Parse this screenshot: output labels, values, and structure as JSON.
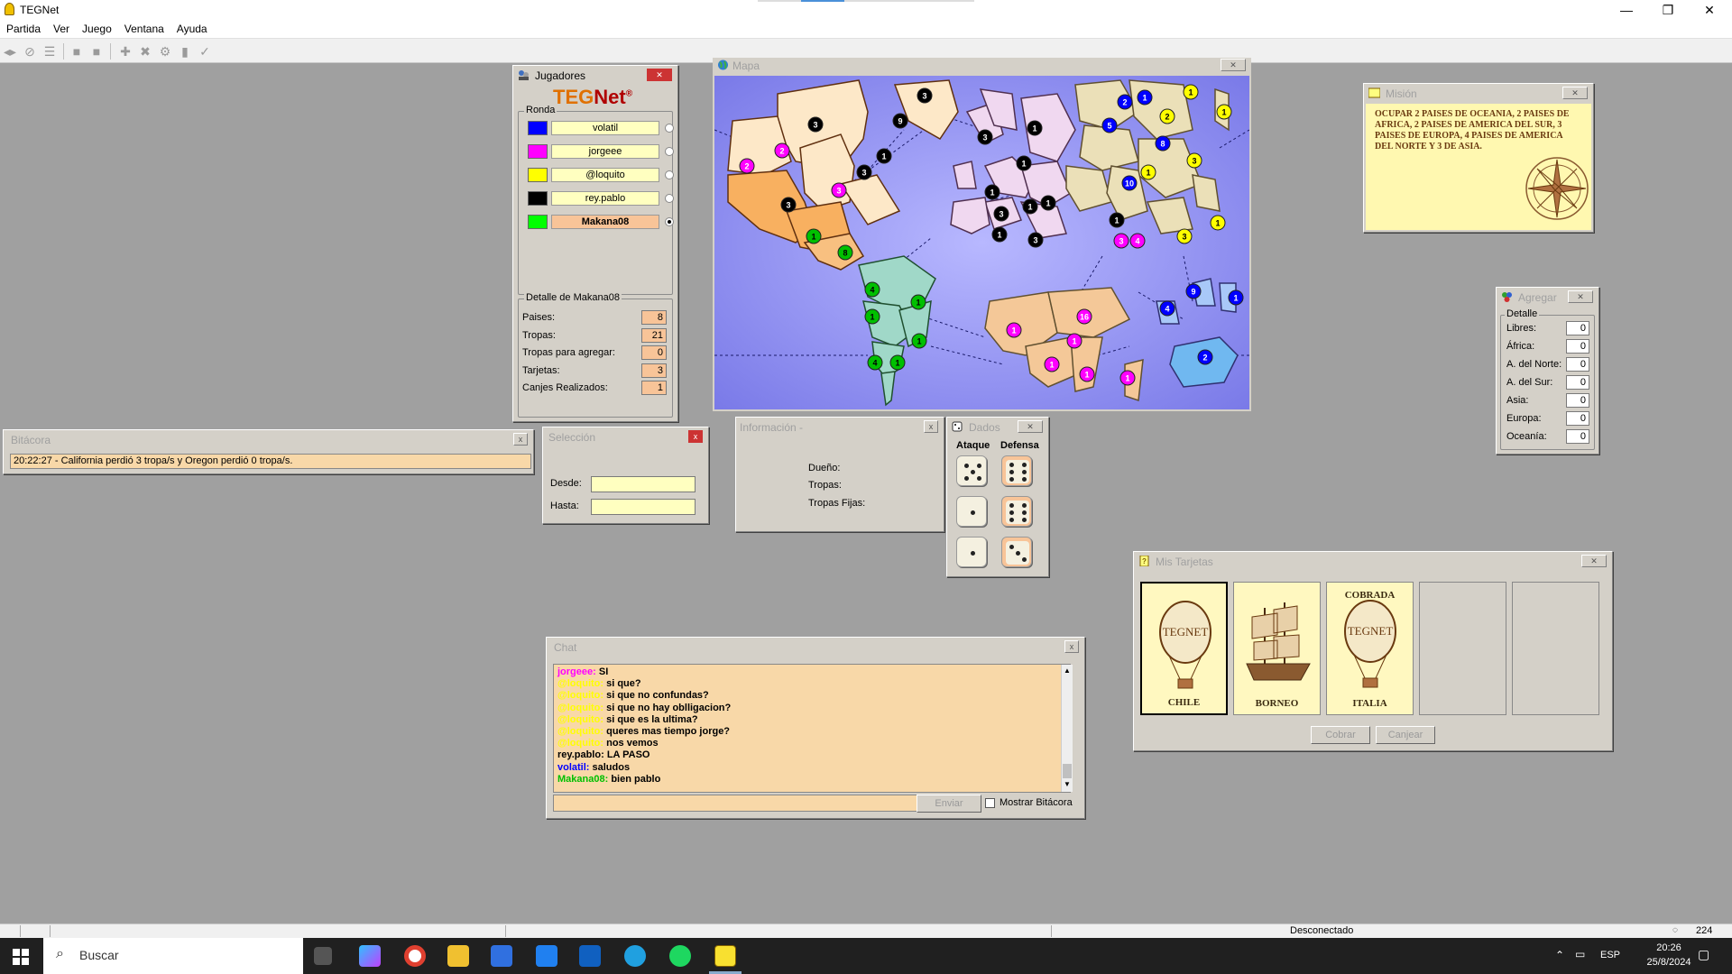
{
  "window": {
    "title": "TEGNet",
    "min_glyph": "—",
    "max_glyph": "❐",
    "close_glyph": "✕"
  },
  "menu": [
    "Partida",
    "Ver",
    "Juego",
    "Ventana",
    "Ayuda"
  ],
  "players_panel": {
    "title": "Jugadores",
    "logo_teg": "TEG",
    "logo_net": "Net",
    "logo_mark": "®",
    "group_label": "Ronda",
    "players": [
      {
        "name": "volatil",
        "color": "#0000ff",
        "active": false
      },
      {
        "name": "jorgeee",
        "color": "#ff00ff",
        "active": false
      },
      {
        "name": "@loquito",
        "color": "#ffff00",
        "active": false
      },
      {
        "name": "rey.pablo",
        "color": "#000000",
        "active": false
      },
      {
        "name": "Makana08",
        "color": "#00ff00",
        "active": true
      }
    ],
    "detail_label": "Detalle de Makana08",
    "stats": [
      {
        "label": "Paises:",
        "value": "8"
      },
      {
        "label": "Tropas:",
        "value": "21"
      },
      {
        "label": "Tropas para agregar:",
        "value": "0"
      },
      {
        "label": "Tarjetas:",
        "value": "3"
      },
      {
        "label": "Canjes Realizados:",
        "value": "1"
      }
    ]
  },
  "map_panel": {
    "title": "Mapa"
  },
  "map_armies": [
    {
      "n": "3",
      "c": "#000",
      "fg": "#fff"
    },
    {
      "n": "2",
      "c": "#ff00ff",
      "fg": "#fff"
    },
    {
      "n": "2",
      "c": "#ff00ff",
      "fg": "#fff"
    },
    {
      "n": "1",
      "c": "#000",
      "fg": "#fff"
    },
    {
      "n": "3",
      "c": "#000",
      "fg": "#fff"
    },
    {
      "n": "3",
      "c": "#000",
      "fg": "#fff"
    },
    {
      "n": "3",
      "c": "#ff00ff",
      "fg": "#fff"
    },
    {
      "n": "9",
      "c": "#000",
      "fg": "#fff"
    },
    {
      "n": "1",
      "c": "#00c000",
      "fg": "#000"
    },
    {
      "n": "8",
      "c": "#00c000",
      "fg": "#000"
    },
    {
      "n": "3",
      "c": "#000",
      "fg": "#fff"
    },
    {
      "n": "4",
      "c": "#00c000",
      "fg": "#000"
    },
    {
      "n": "1",
      "c": "#00c000",
      "fg": "#000"
    },
    {
      "n": "1",
      "c": "#00c000",
      "fg": "#000"
    },
    {
      "n": "1",
      "c": "#00c000",
      "fg": "#000"
    },
    {
      "n": "4",
      "c": "#00c000",
      "fg": "#000"
    },
    {
      "n": "1",
      "c": "#00c000",
      "fg": "#000"
    },
    {
      "n": "3",
      "c": "#000",
      "fg": "#fff"
    },
    {
      "n": "1",
      "c": "#000",
      "fg": "#fff"
    },
    {
      "n": "1",
      "c": "#000",
      "fg": "#fff"
    },
    {
      "n": "1",
      "c": "#000",
      "fg": "#fff"
    },
    {
      "n": "1",
      "c": "#000",
      "fg": "#fff"
    },
    {
      "n": "3",
      "c": "#000",
      "fg": "#fff"
    },
    {
      "n": "1",
      "c": "#000",
      "fg": "#fff"
    },
    {
      "n": "1",
      "c": "#000",
      "fg": "#fff"
    },
    {
      "n": "3",
      "c": "#000",
      "fg": "#fff"
    },
    {
      "n": "2",
      "c": "#0000ff",
      "fg": "#fff"
    },
    {
      "n": "1",
      "c": "#0000ff",
      "fg": "#fff"
    },
    {
      "n": "1",
      "c": "#ffff00",
      "fg": "#000"
    },
    {
      "n": "1",
      "c": "#ffff00",
      "fg": "#000"
    },
    {
      "n": "5",
      "c": "#0000ff",
      "fg": "#fff"
    },
    {
      "n": "2",
      "c": "#ffff00",
      "fg": "#000"
    },
    {
      "n": "8",
      "c": "#0000ff",
      "fg": "#fff"
    },
    {
      "n": "3",
      "c": "#ffff00",
      "fg": "#000"
    },
    {
      "n": "1",
      "c": "#ffff00",
      "fg": "#000"
    },
    {
      "n": "10",
      "c": "#0000ff",
      "fg": "#fff"
    },
    {
      "n": "1",
      "c": "#000",
      "fg": "#fff"
    },
    {
      "n": "3",
      "c": "#ff00ff",
      "fg": "#fff"
    },
    {
      "n": "4",
      "c": "#ff00ff",
      "fg": "#fff"
    },
    {
      "n": "3",
      "c": "#ffff00",
      "fg": "#000"
    },
    {
      "n": "1",
      "c": "#ffff00",
      "fg": "#000"
    },
    {
      "n": "9",
      "c": "#0000ff",
      "fg": "#fff"
    },
    {
      "n": "1",
      "c": "#0000ff",
      "fg": "#fff"
    },
    {
      "n": "4",
      "c": "#0000ff",
      "fg": "#fff"
    },
    {
      "n": "2",
      "c": "#0000ff",
      "fg": "#fff"
    },
    {
      "n": "1",
      "c": "#ff00ff",
      "fg": "#fff"
    },
    {
      "n": "16",
      "c": "#ff00ff",
      "fg": "#fff"
    },
    {
      "n": "1",
      "c": "#ff00ff",
      "fg": "#fff"
    },
    {
      "n": "1",
      "c": "#ff00ff",
      "fg": "#fff"
    },
    {
      "n": "1",
      "c": "#ff00ff",
      "fg": "#fff"
    },
    {
      "n": "1",
      "c": "#ff00ff",
      "fg": "#fff"
    }
  ],
  "mission_panel": {
    "title": "Misión",
    "text": "OCUPAR 2 PAISES DE OCEANIA, 2 PAISES DE AFRICA, 2 PAISES DE AMERICA DEL SUR, 3 PAISES DE EUROPA, 4 PAISES DE AMERICA DEL NORTE Y 3 DE ASIA."
  },
  "add_panel": {
    "title": "Agregar",
    "group_label": "Detalle",
    "rows": [
      {
        "label": "Libres:",
        "value": "0"
      },
      {
        "label": "África:",
        "value": "0"
      },
      {
        "label": "A. del Norte:",
        "value": "0"
      },
      {
        "label": "A. del Sur:",
        "value": "0"
      },
      {
        "label": "Asia:",
        "value": "0"
      },
      {
        "label": "Europa:",
        "value": "0"
      },
      {
        "label": "Oceanía:",
        "value": "0"
      }
    ]
  },
  "log_panel": {
    "title": "Bitácora",
    "entry": "20:22:27 - California perdió 3 tropa/s y Oregon perdió 0 tropa/s.",
    "close": "x"
  },
  "selection_panel": {
    "title": "Selección",
    "from_label": "Desde:",
    "to_label": "Hasta:",
    "from_value": "",
    "to_value": "",
    "close": "x"
  },
  "info_panel": {
    "title": "Información -",
    "owner_label": "Dueño:",
    "troops_label": "Tropas:",
    "fixed_label": "Tropas Fijas:",
    "close": "x"
  },
  "dice_panel": {
    "title": "Dados",
    "attack_label": "Ataque",
    "defense_label": "Defensa",
    "attack": [
      5,
      1,
      1
    ],
    "defense": [
      6,
      6,
      3
    ]
  },
  "cards_panel": {
    "title": "Mis Tarjetas",
    "cards": [
      {
        "name": "CHILE",
        "top": "",
        "image": "balloon",
        "selected": true
      },
      {
        "name": "BORNEO",
        "top": "",
        "image": "ship",
        "selected": false
      },
      {
        "name": "ITALIA",
        "top": "COBRADA",
        "image": "balloon",
        "selected": false
      },
      {
        "name": "",
        "top": "",
        "image": "",
        "selected": false
      },
      {
        "name": "",
        "top": "",
        "image": "",
        "selected": false
      }
    ],
    "collect_btn": "Cobrar",
    "exchange_btn": "Canjear",
    "balloon_text": "TEGNET"
  },
  "chat_panel": {
    "title": "Chat",
    "close": "x",
    "messages": [
      {
        "who": "jorgeee:",
        "color": "#ff00ff",
        "text": "SI"
      },
      {
        "who": "@loquito:",
        "color": "#ffff00",
        "text": "si que?"
      },
      {
        "who": "@loquito:",
        "color": "#ffff00",
        "text": "si que no confundas?"
      },
      {
        "who": "@loquito:",
        "color": "#ffff00",
        "text": "si que no hay oblligacion?"
      },
      {
        "who": "@loquito:",
        "color": "#ffff00",
        "text": "si que es la ultima?"
      },
      {
        "who": "@loquito:",
        "color": "#ffff00",
        "text": "queres mas tiempo jorge?"
      },
      {
        "who": "@loquito:",
        "color": "#ffff00",
        "text": "nos vemos"
      },
      {
        "who": "rey.pablo:",
        "color": "#000000",
        "text": "LA PASO"
      },
      {
        "who": "volatil:",
        "color": "#0000ff",
        "text": "saludos"
      },
      {
        "who": "Makana08:",
        "color": "#00c000",
        "text": "bien pablo"
      }
    ],
    "input_value": "",
    "send_btn": "Enviar",
    "show_log_label": "Mostrar Bitácora"
  },
  "status_bar": {
    "text": "Desconectado",
    "count": "224"
  },
  "taskbar": {
    "search": "Buscar",
    "lang": "ESP",
    "time": "20:26",
    "date": "25/8/2024"
  }
}
